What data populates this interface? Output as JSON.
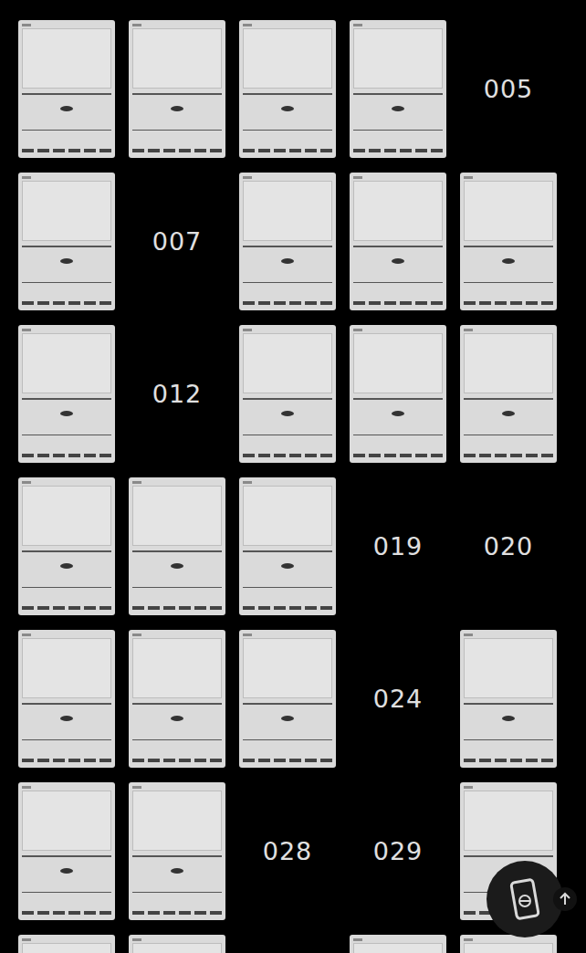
{
  "cards": [
    {
      "owned": true
    },
    {
      "owned": true
    },
    {
      "owned": true
    },
    {
      "owned": true
    },
    {
      "owned": false,
      "number": "005"
    },
    {
      "owned": true
    },
    {
      "owned": false,
      "number": "007"
    },
    {
      "owned": true
    },
    {
      "owned": true
    },
    {
      "owned": true
    },
    {
      "owned": true
    },
    {
      "owned": false,
      "number": "012"
    },
    {
      "owned": true
    },
    {
      "owned": true
    },
    {
      "owned": true
    },
    {
      "owned": true
    },
    {
      "owned": true
    },
    {
      "owned": true
    },
    {
      "owned": false,
      "number": "019"
    },
    {
      "owned": false,
      "number": "020"
    },
    {
      "owned": true
    },
    {
      "owned": true
    },
    {
      "owned": true
    },
    {
      "owned": false,
      "number": "024"
    },
    {
      "owned": true
    },
    {
      "owned": true
    },
    {
      "owned": true
    },
    {
      "owned": false,
      "number": "028"
    },
    {
      "owned": false,
      "number": "029"
    },
    {
      "owned": true
    },
    {
      "owned": true
    },
    {
      "owned": true
    },
    {
      "owned": false
    },
    {
      "owned": true
    },
    {
      "owned": true
    }
  ]
}
